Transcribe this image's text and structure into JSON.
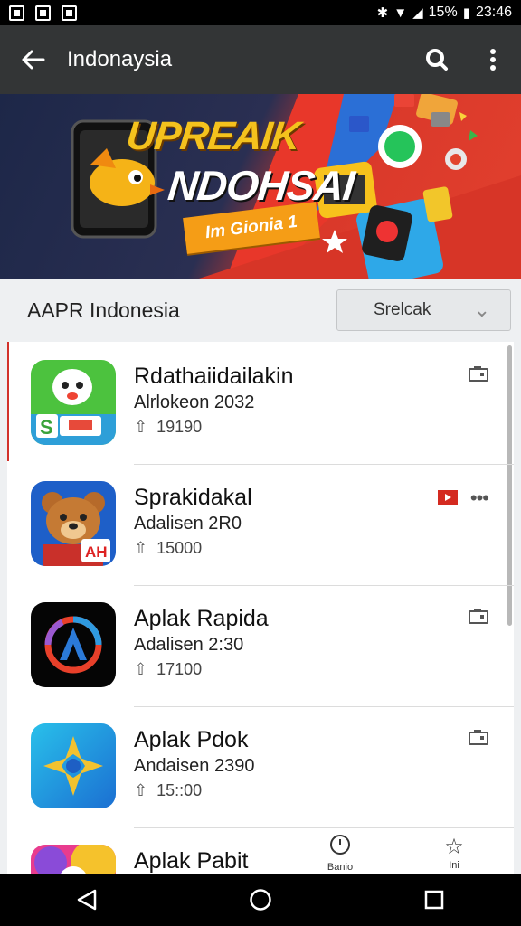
{
  "status_bar": {
    "battery": "15%",
    "time": "23:46"
  },
  "app_bar": {
    "title": "Indonaysia"
  },
  "banner": {
    "title_line1": "UPREAIK",
    "title_line2": "NDOHSAI",
    "badge": "Im Gionia 1",
    "accent_color": "#f4c21d"
  },
  "filter": {
    "label": "AAPR Indonesia",
    "select_value": "Srelcak"
  },
  "apps": [
    {
      "name": "Rdathaiidailakin",
      "subtitle": "Alrlokeon 2032",
      "downloads": "19190",
      "icon": "mascot-icon",
      "action": "cast-icon"
    },
    {
      "name": "Sprakidakal",
      "subtitle": "Adalisen 2R0",
      "downloads": "15000",
      "icon": "bear-icon",
      "action": "more-icon"
    },
    {
      "name": "Aplak Rapida",
      "subtitle": "Adalisen 2:30",
      "downloads": "17100",
      "icon": "ring-logo-icon",
      "action": "cast-icon"
    },
    {
      "name": "Aplak Pdok",
      "subtitle": "Andaisen 2390",
      "downloads": "15::00",
      "icon": "compass-icon",
      "action": "cast-icon"
    },
    {
      "name": "Aplak Pabit",
      "subtitle": "",
      "downloads": "",
      "icon": "colorful-icon",
      "action": "more-icon"
    }
  ],
  "bottom_actions": [
    {
      "label": "Banio",
      "icon": "clock-icon"
    },
    {
      "label": "Ini",
      "icon": "star-icon"
    }
  ]
}
